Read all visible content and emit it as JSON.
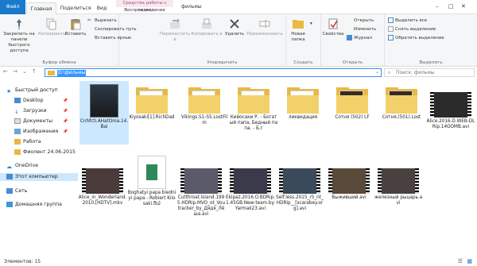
{
  "tabs": {
    "file": "Файл",
    "home": "Главная",
    "share": "Поделиться",
    "view": "Вид",
    "context_header": "Средства работы с видео",
    "playback": "Воспроизведение"
  },
  "window_title": "фильмы",
  "ribbon": {
    "clipboard": {
      "pin": "Закрепить на панели быстрого доступа",
      "copy": "Копировать",
      "paste": "Вставить",
      "cut": "Вырезать",
      "copy_path": "Скопировать путь",
      "paste_shortcut": "Вставить ярлык",
      "label": "Буфер обмена"
    },
    "organize": {
      "move": "Переместить в",
      "copy_to": "Копировать в",
      "delete": "Удалить",
      "rename": "Переименовать",
      "label": "Упорядочить"
    },
    "new": {
      "new_folder": "Новая папка",
      "label": "Создать"
    },
    "open": {
      "properties": "Свойства",
      "open": "Открыть",
      "edit": "Изменить",
      "history": "Журнал",
      "label": "Открыть"
    },
    "select": {
      "select_all": "Выделить все",
      "select_none": "Снять выделение",
      "invert": "Обратить выделение",
      "label": "Выделить"
    }
  },
  "address": {
    "path": "D:\\фильмы",
    "search_placeholder": "Поиск: фильмы"
  },
  "nav": {
    "quick_access": "Быстрый доступ",
    "items": [
      {
        "label": "Desktop",
        "pinned": true
      },
      {
        "label": "Загрузки",
        "pinned": true
      },
      {
        "label": "Документы",
        "pinned": true
      },
      {
        "label": "Изображения",
        "pinned": true
      },
      {
        "label": "Работа",
        "pinned": false
      },
      {
        "label": "Фиолент 24.06.2015",
        "pinned": false
      }
    ],
    "onedrive": "OneDrive",
    "this_pc": "Этот компьютер",
    "network": "Сеть",
    "homegroup": "Домашняя группа"
  },
  "files": [
    {
      "name": "Cnhfcti.AHatOma.14.Bai",
      "type": "video"
    },
    {
      "name": "Kiyosaki[1].RichDad",
      "type": "folder"
    },
    {
      "name": "Vikings.S1-S5.LostFilm",
      "type": "folder"
    },
    {
      "name": "Кийосаки Р. - Богатый папа, Бедный папа. - Б.г",
      "type": "folder"
    },
    {
      "name": "ликвидация",
      "type": "folder"
    },
    {
      "name": "Сотня (502) LF",
      "type": "folder"
    },
    {
      "name": "Сотня.(501).Lost",
      "type": "folder"
    },
    {
      "name": "Alice.2016.D.WEB-DLRip.14OOMB.avi",
      "type": "video"
    },
    {
      "name": "Alice_in_Wonderland.2010.[HDTV].mkv",
      "type": "video"
    },
    {
      "name": "Boghatyi papa biedniyi papa - Robiert Kiiosaki.fb2",
      "type": "book"
    },
    {
      "name": "Cutthroat.Island.1995.HDRip.MVO_ot_Voutracker_by_Дядя_Лёша.avi",
      "type": "video"
    },
    {
      "name": "Ekipaz.2016.O.BDRip.1.45GB.New-team.by.Yarmak23.avi",
      "type": "video"
    },
    {
      "name": "Self.less.2015_r5_nt_HDRip__[scarabey.org].avi",
      "type": "video"
    },
    {
      "name": "Выживший.avi",
      "type": "video"
    },
    {
      "name": "железный рыцарь.avi",
      "type": "video"
    }
  ],
  "status": "Элементов: 15",
  "colors": {
    "file_tab": "#1979ca",
    "selection": "#cce8ff",
    "folder": "#e8b944",
    "accent": "#3399ff"
  }
}
